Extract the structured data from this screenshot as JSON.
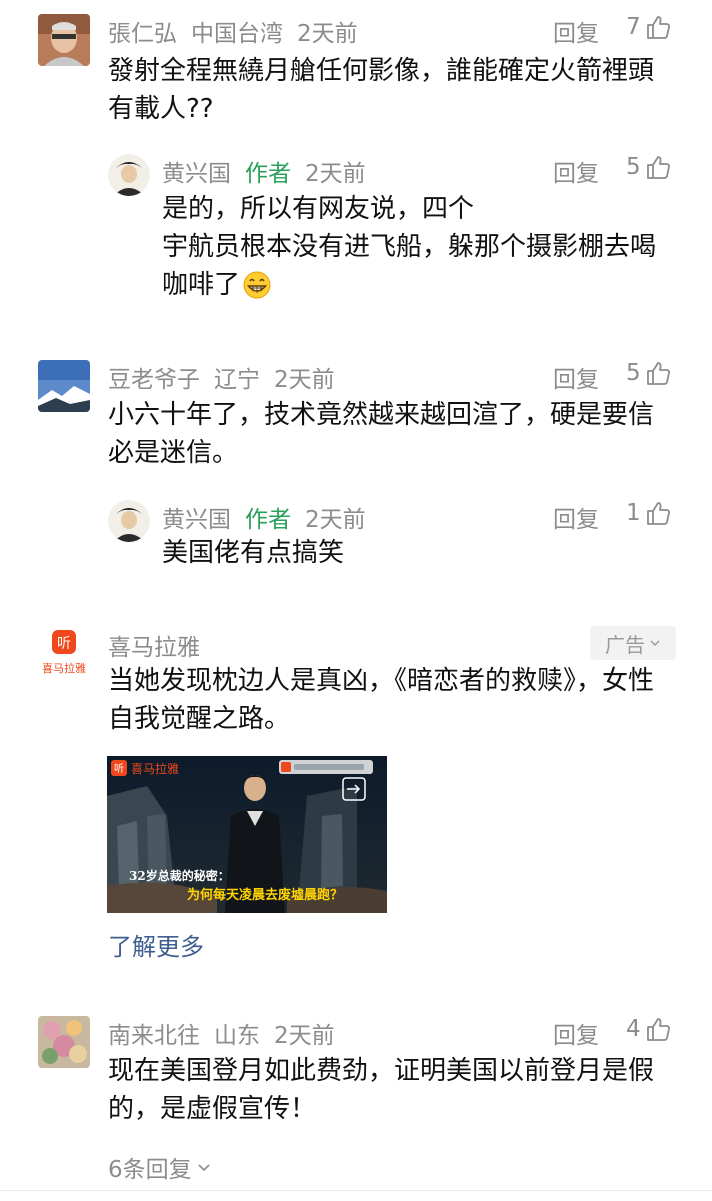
{
  "comments": [
    {
      "user": "張仁弘",
      "location": "中国台湾",
      "time": "2天前",
      "reply_label": "回复",
      "likes": "7",
      "text_lines": [
        "發射全程無繞月艙任何影像，誰能確定火箭裡頭",
        "有載人??"
      ],
      "reply": {
        "user": "黄兴国",
        "tag": "作者",
        "time": "2天前",
        "reply_label": "回复",
        "likes": "5",
        "text_lines": [
          "是的，所以有网友说，四个",
          "宇航员根本没有进飞船，躲那个摄影棚去喝",
          "咖啡了"
        ],
        "emoji": "grinning-emoji"
      }
    },
    {
      "user": "豆老爷子",
      "location": "辽宁",
      "time": "2天前",
      "reply_label": "回复",
      "likes": "5",
      "text_lines": [
        "小六十年了，技术竟然越来越回渲了，硬是要信",
        "必是迷信。"
      ],
      "reply": {
        "user": "黄兴国",
        "tag": "作者",
        "time": "2天前",
        "reply_label": "回复",
        "likes": "1",
        "text_lines": [
          "美国佬有点搞笑"
        ]
      }
    },
    {
      "user": "南来北往",
      "location": "山东",
      "time": "2天前",
      "reply_label": "回复",
      "likes": "4",
      "text_lines": [
        "现在美国登月如此费劲，证明美国以前登月是假",
        "的，是虚假宣传！"
      ],
      "more_replies": "6条回复"
    }
  ],
  "ad": {
    "brand": "喜马拉雅",
    "logo_text": "喜马拉雅",
    "logo_glyph": "听",
    "badge": "广告",
    "text_lines": [
      "当她发现枕边人是真凶，《暗恋者的救赎》，女性",
      "自我觉醒之路。"
    ],
    "image_overlay_logo": "喜马拉雅",
    "image_overlay_glyph": "听",
    "image_caption_1": "32岁总裁的秘密：",
    "image_caption_2": "为何每天凌晨去废墟晨跑？",
    "learn_more": "了解更多"
  },
  "colors": {
    "meta": "#8c8c8c",
    "author_tag": "#2aa05a",
    "link": "#3f5f90",
    "brand_orange": "#f0481c"
  }
}
